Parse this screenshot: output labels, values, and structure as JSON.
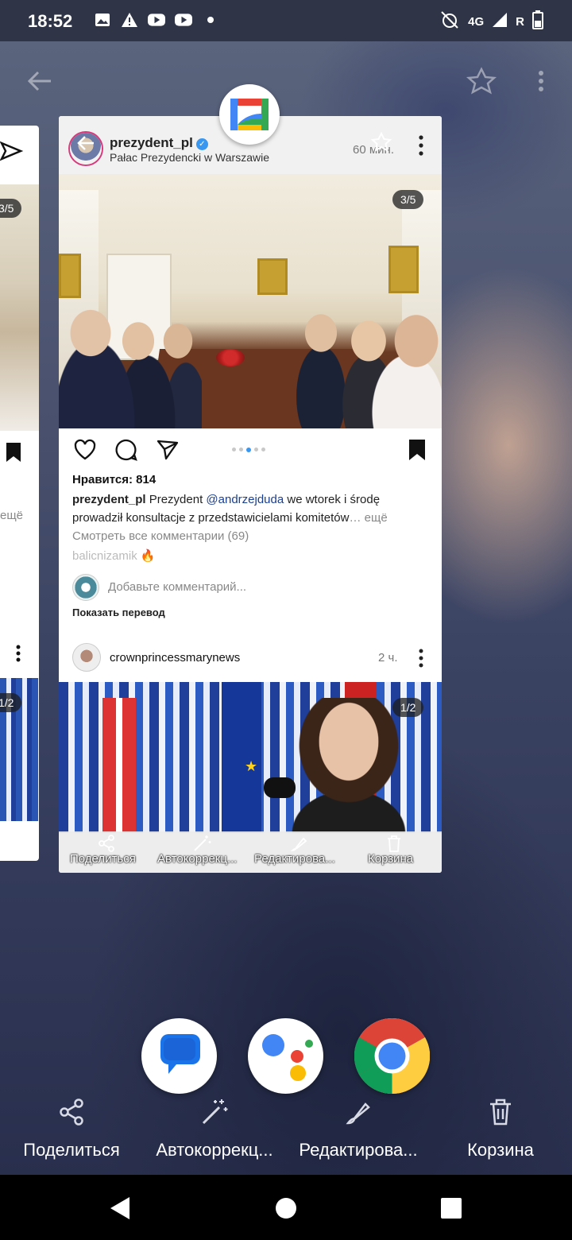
{
  "status_bar": {
    "time": "18:52",
    "network": "4G",
    "roaming": "R",
    "left_icons": [
      "gallery-icon",
      "drive-warning-icon",
      "youtube-icon",
      "youtube-icon",
      "dot-icon"
    ],
    "right_icons": [
      "alarm-off-icon",
      "signal-icon",
      "battery-icon"
    ]
  },
  "viewer": {
    "back_icon": "arrow-back-icon",
    "favorite_icon": "star-icon",
    "more_icon": "more-vert-icon"
  },
  "app_card": {
    "app_icon": "google-gallery-icon",
    "post1": {
      "username": "prezydent_pl",
      "location": "Pałac Prezydencki w Warszawie",
      "time": "60 мин.",
      "image_counter": "3/5",
      "likes": "Нравится: 814",
      "caption_user": "prezydent_pl",
      "caption_text_1": " Prezydent ",
      "caption_mention": "@andrzejduda",
      "caption_text_2": " we wtorek i środę prowadził konsultacje z przedstawicielami komitetów",
      "caption_more": "… ещё",
      "view_comments": "Смотреть все комментарии (69)",
      "commenter": "balicnizamik 🔥",
      "add_comment_placeholder": "Добавьте комментарий...",
      "show_translation": "Показать перевод",
      "carousel_dots": 5,
      "carousel_active": 2
    },
    "post2": {
      "username": "crownprincessmarynews",
      "time": "2 ч.",
      "image_counter": "1/2"
    },
    "edit_bar": {
      "share": "Поделиться",
      "autocorrect": "Автокоррекц...",
      "edit": "Редактирова...",
      "trash": "Корзина"
    }
  },
  "left_card": {
    "image_counter_1": "3/5",
    "more_text": "ещё",
    "image_counter_2": "1/2"
  },
  "dock": {
    "apps": [
      "messages-icon",
      "google-assistant-icon",
      "chrome-icon"
    ]
  },
  "bottom_actions": {
    "share": "Поделиться",
    "autocorrect": "Автокоррекц...",
    "edit": "Редактирова...",
    "trash": "Корзина"
  },
  "nav": {
    "back": "nav-back-icon",
    "home": "nav-home-icon",
    "recents": "nav-recents-icon"
  },
  "colors": {
    "instagram_link": "#1b3f8f",
    "carousel_active": "#3897f0",
    "verified": "#3897f0"
  }
}
